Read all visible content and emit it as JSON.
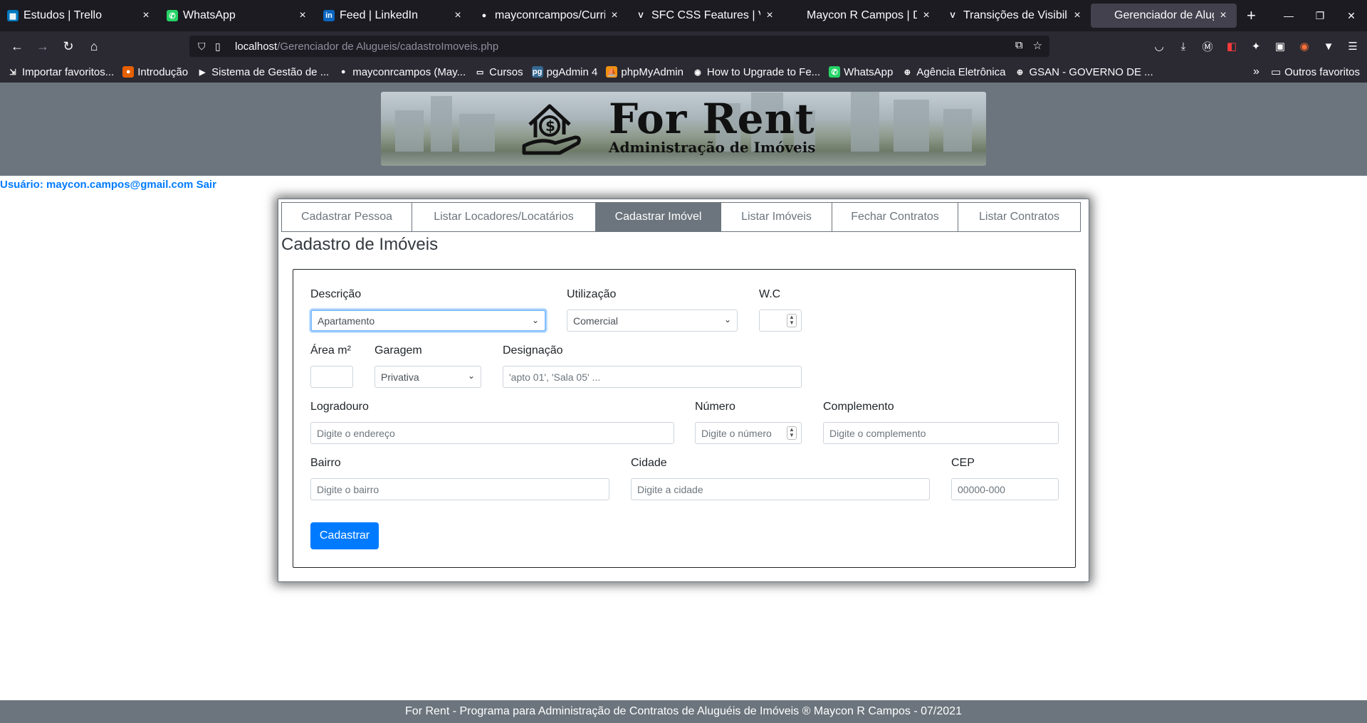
{
  "browser": {
    "tabs": [
      {
        "label": "Estudos | Trello",
        "icon": "trello-icon",
        "color": "#0079bf",
        "glyph": "▦"
      },
      {
        "label": "WhatsApp",
        "icon": "whatsapp-icon",
        "color": "#25d366",
        "glyph": "✆"
      },
      {
        "label": "Feed | LinkedIn",
        "icon": "linkedin-icon",
        "color": "#0a66c2",
        "glyph": "in"
      },
      {
        "label": "mayconrcampos/Curricu",
        "icon": "github-icon",
        "color": "#1c1b22",
        "glyph": "●"
      },
      {
        "label": "SFC CSS Features | Vue.j",
        "icon": "vue-icon",
        "color": "#1c1b22",
        "glyph": "V"
      },
      {
        "label": "Maycon R Campos | DEV Ful",
        "icon": "dev-icon",
        "color": "#1c1b22",
        "glyph": ""
      },
      {
        "label": "Transições de Visibilidad",
        "icon": "vue-icon",
        "color": "#1c1b22",
        "glyph": "V"
      },
      {
        "label": "Gerenciador de Aluguéis - L",
        "icon": "page-icon",
        "color": "#42414d",
        "glyph": ""
      }
    ],
    "new_tab": "+",
    "url_host": "localhost",
    "url_path": "/Gerenciador de Alugueis/cadastroImoveis.php",
    "bookmarks": [
      {
        "label": "Importar favoritos...",
        "icon": "import-icon",
        "color": "#2b2a33",
        "glyph": "⇲"
      },
      {
        "label": "Introdução",
        "icon": "firefox-icon",
        "color": "#e66000",
        "glyph": "●"
      },
      {
        "label": "Sistema de Gestão de ...",
        "icon": "play-icon",
        "color": "#2b2a33",
        "glyph": "▶"
      },
      {
        "label": "mayconrcampos (May...",
        "icon": "github-icon",
        "color": "#2b2a33",
        "glyph": "●"
      },
      {
        "label": "Cursos",
        "icon": "folder-icon",
        "color": "#2b2a33",
        "glyph": "▭"
      },
      {
        "label": "pgAdmin 4",
        "icon": "pgadmin-icon",
        "color": "#336791",
        "glyph": "pg"
      },
      {
        "label": "phpMyAdmin",
        "icon": "phpmyadmin-icon",
        "color": "#f29111",
        "glyph": "⛵"
      },
      {
        "label": "How to Upgrade to Fe...",
        "icon": "fedora-icon",
        "color": "#2b2a33",
        "glyph": "◉"
      },
      {
        "label": "WhatsApp",
        "icon": "whatsapp-icon",
        "color": "#25d366",
        "glyph": "✆"
      },
      {
        "label": "Agência Eletrônica",
        "icon": "globe-icon",
        "color": "#2b2a33",
        "glyph": "⊕"
      },
      {
        "label": "GSAN - GOVERNO DE ...",
        "icon": "globe-icon",
        "color": "#2b2a33",
        "glyph": "⊕"
      }
    ],
    "other_bookmarks": "Outros favoritos"
  },
  "header": {
    "brand_title": "For Rent",
    "brand_subtitle": "Administração de Imóveis"
  },
  "user": {
    "prefix": "Usuário:",
    "email": "maycon.campos@gmail.com",
    "logout": "Sair"
  },
  "nav": [
    {
      "label": "Cadastrar Pessoa",
      "active": false
    },
    {
      "label": "Listar Locadores/Locatários",
      "active": false
    },
    {
      "label": "Cadastrar Imóvel",
      "active": true
    },
    {
      "label": "Listar Imóveis",
      "active": false
    },
    {
      "label": "Fechar Contratos",
      "active": false
    },
    {
      "label": "Listar Contratos",
      "active": false
    }
  ],
  "form": {
    "title": "Cadastro de Imóveis",
    "descricao": {
      "label": "Descrição",
      "value": "Apartamento"
    },
    "utilizacao": {
      "label": "Utilização",
      "value": "Comercial"
    },
    "wc": {
      "label": "W.C",
      "value": ""
    },
    "area": {
      "label": "Área m²",
      "value": ""
    },
    "garagem": {
      "label": "Garagem",
      "value": "Privativa"
    },
    "designacao": {
      "label": "Designação",
      "placeholder": "'apto 01', 'Sala 05' ..."
    },
    "logradouro": {
      "label": "Logradouro",
      "placeholder": "Digite o endereço"
    },
    "numero": {
      "label": "Número",
      "placeholder": "Digite o número"
    },
    "complemento": {
      "label": "Complemento",
      "placeholder": "Digite o complemento"
    },
    "bairro": {
      "label": "Bairro",
      "placeholder": "Digite o bairro"
    },
    "cidade": {
      "label": "Cidade",
      "placeholder": "Digite a cidade"
    },
    "cep": {
      "label": "CEP",
      "placeholder": "00000-000"
    },
    "submit": "Cadastrar"
  },
  "footer": "For Rent - Programa para Administração de Contratos de Aluguéis de Imóveis ® Maycon R Campos - 07/2021",
  "colors": {
    "primary": "#007bff",
    "secondary": "#6c757d"
  }
}
